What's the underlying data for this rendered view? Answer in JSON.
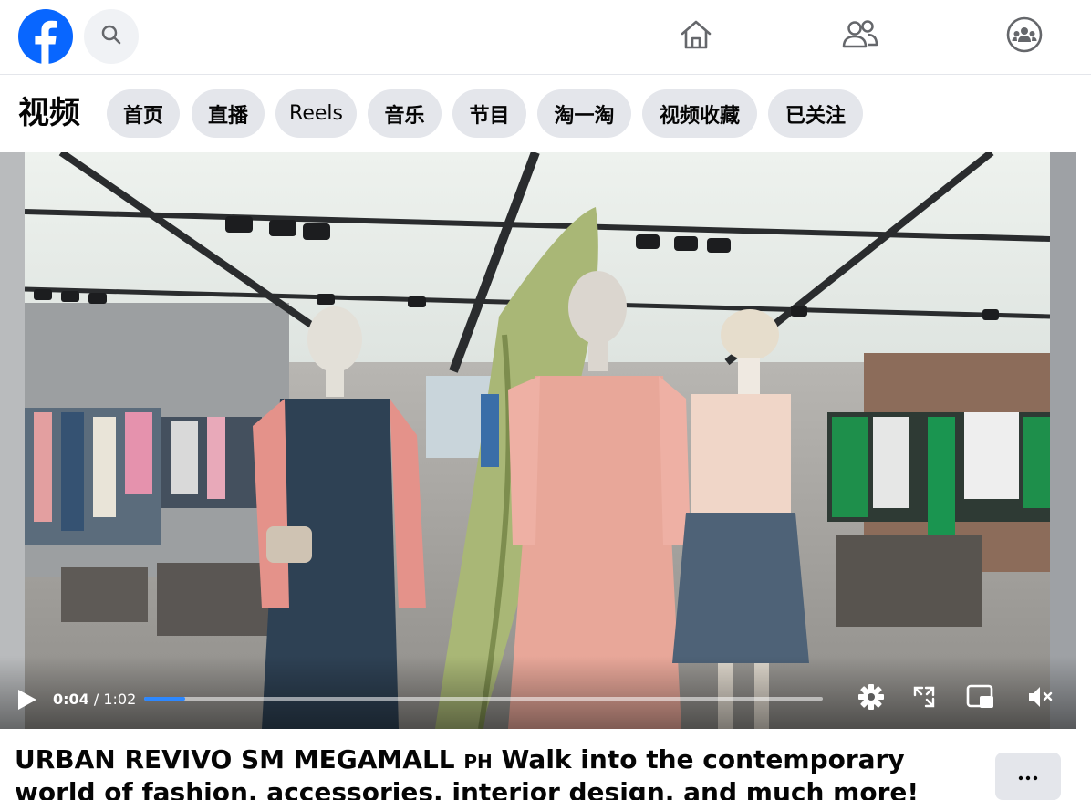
{
  "header": {
    "logo_icon": "facebook-logo-icon",
    "brand_color": "#0866ff",
    "search_icon": "search-icon",
    "nav": [
      {
        "name": "home",
        "icon": "home-icon"
      },
      {
        "name": "friends",
        "icon": "friends-icon"
      },
      {
        "name": "groups",
        "icon": "groups-icon"
      }
    ]
  },
  "categories": {
    "title": "视频",
    "pills": [
      "首页",
      "直播",
      "Reels",
      "音乐",
      "节目",
      "淘一淘",
      "视频收藏",
      "已关注"
    ]
  },
  "player": {
    "current_time": "0:04",
    "separator": " / ",
    "duration": "1:02",
    "progress_fraction": 0.061,
    "progress_color": "#2d88ff",
    "icons": [
      "play-icon",
      "settings-gear-icon",
      "fullscreen-icon",
      "picture-in-picture-icon",
      "muted-volume-icon"
    ]
  },
  "post": {
    "author": "URBAN REVIVO SM MEGAMALL",
    "author_suffix": "PH",
    "text": "Walk into the contemporary world of fashion, accessories, interior design, and much more! #URBANREVIVOP...",
    "more_icon": "more-dots-icon"
  }
}
